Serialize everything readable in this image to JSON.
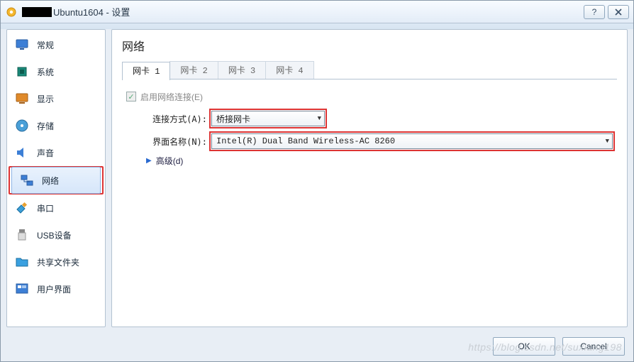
{
  "window": {
    "title_suffix": "Ubuntu1604 - 设置"
  },
  "sidebar": {
    "items": [
      {
        "label": "常规"
      },
      {
        "label": "系统"
      },
      {
        "label": "显示"
      },
      {
        "label": "存储"
      },
      {
        "label": "声音"
      },
      {
        "label": "网络"
      },
      {
        "label": "串口"
      },
      {
        "label": "USB设备"
      },
      {
        "label": "共享文件夹"
      },
      {
        "label": "用户界面"
      }
    ]
  },
  "page": {
    "title": "网络",
    "tabs": [
      "网卡 1",
      "网卡 2",
      "网卡 3",
      "网卡 4"
    ],
    "enable_label": "启用网络连接(E)",
    "attached_label": "连接方式(A):",
    "attached_value": "桥接网卡",
    "name_label": "界面名称(N):",
    "name_value": "Intel(R) Dual Band Wireless-AC 8260",
    "advanced_label": "高级(d)"
  },
  "footer": {
    "ok": "OK",
    "cancel": "Cancel"
  },
  "watermark": "https://blog.csdn.net/suxiang198"
}
